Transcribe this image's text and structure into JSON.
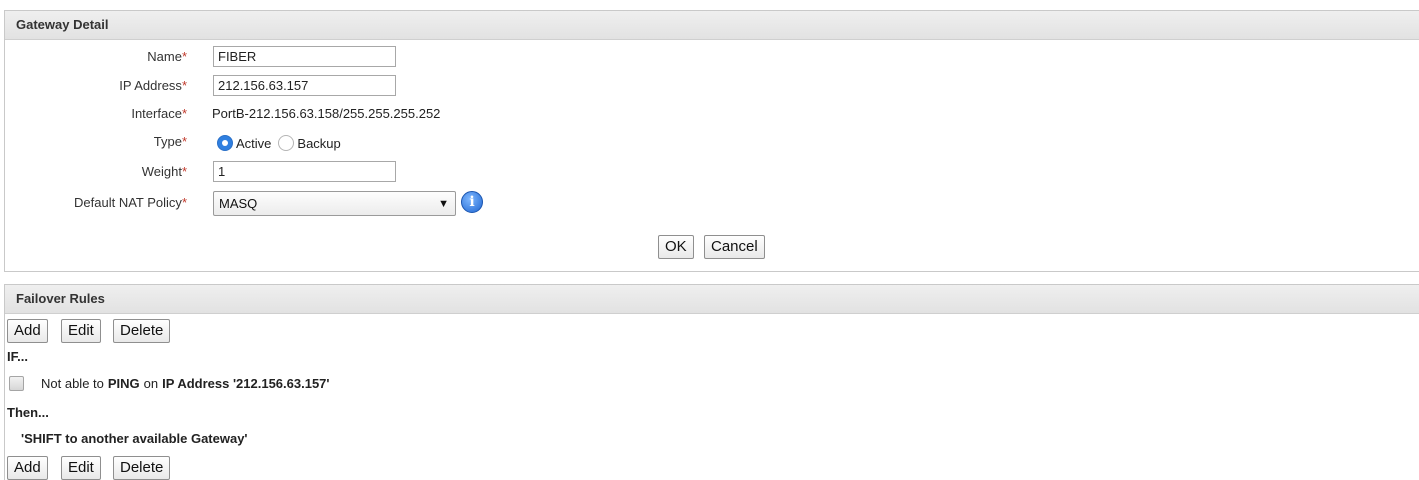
{
  "gateway_detail": {
    "title": "Gateway Detail",
    "required_marker": "*",
    "name_label": "Name",
    "name_value": "FIBER",
    "ip_label": "IP Address",
    "ip_value": "212.156.63.157",
    "interface_label": "Interface",
    "interface_value": "PortB-212.156.63.158/255.255.255.252",
    "type_label": "Type",
    "type_options": [
      "Active",
      "Backup"
    ],
    "type_selected": "Active",
    "weight_label": "Weight",
    "weight_value": "1",
    "nat_label": "Default NAT Policy",
    "nat_value": "MASQ",
    "nat_arrow": "▼",
    "info_icon_glyph": "i",
    "ok_label": "OK",
    "cancel_label": "Cancel"
  },
  "failover_rules": {
    "title": "Failover Rules",
    "add_label": "Add",
    "edit_label": "Edit",
    "delete_label": "Delete",
    "if_label": "IF...",
    "condition_prefix": "Not able to",
    "condition_method": "PING",
    "condition_on": "on",
    "condition_target": "IP Address '212.156.63.157'",
    "then_label": "Then...",
    "action_text": "'SHIFT to another available Gateway'"
  },
  "colors": {
    "required": "#c0392b",
    "radio_selected": "#2f7fe0",
    "info_icon": "#1f66d1"
  }
}
